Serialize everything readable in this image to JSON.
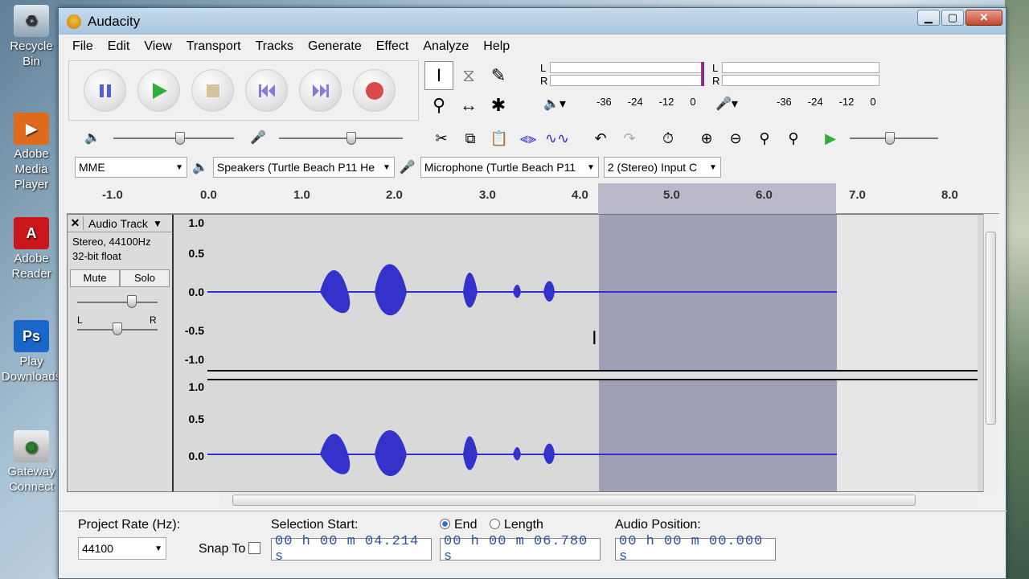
{
  "desktop": {
    "icons": [
      "Recycle Bin",
      "Adobe Media Player",
      "Adobe Reader",
      "Play Downloads",
      "Gateway Connect"
    ]
  },
  "window": {
    "title": "Audacity"
  },
  "menu": [
    "File",
    "Edit",
    "View",
    "Transport",
    "Tracks",
    "Generate",
    "Effect",
    "Analyze",
    "Help"
  ],
  "meters": {
    "playback_scale": [
      "-36",
      "-24",
      "-12",
      "0"
    ],
    "record_scale": [
      "-36",
      "-24",
      "-12",
      "0"
    ],
    "channel_l": "L",
    "channel_r": "R"
  },
  "devices": {
    "host": "MME",
    "output": "Speakers (Turtle Beach P11 He",
    "input": "Microphone (Turtle Beach P11",
    "channels": "2 (Stereo) Input C"
  },
  "ruler": [
    "-1.0",
    "0.0",
    "1.0",
    "2.0",
    "3.0",
    "4.0",
    "5.0",
    "6.0",
    "7.0",
    "8.0"
  ],
  "track": {
    "name": "Audio Track",
    "format": "Stereo, 44100Hz",
    "bit_depth": "32-bit float",
    "mute": "Mute",
    "solo": "Solo",
    "pan_l": "L",
    "pan_r": "R",
    "scale_ch1": [
      "1.0",
      "0.5",
      "0.0",
      "-0.5",
      "-1.0"
    ],
    "scale_ch2": [
      "1.0",
      "0.5",
      "0.0"
    ]
  },
  "selection_bar": {
    "project_rate_label": "Project Rate (Hz):",
    "project_rate": "44100",
    "snap_to": "Snap To",
    "selection_start_label": "Selection Start:",
    "end_label": "End",
    "length_label": "Length",
    "audio_position_label": "Audio Position:",
    "selection_start": "00 h 00 m 04.214 s",
    "end": "00 h 00 m 06.780 s",
    "audio_position": "00 h 00 m 00.000 s"
  },
  "colors": {
    "waveform": "#3333cc",
    "selection": "#9f9fb8",
    "record": "#d94a4a",
    "play": "#2fae3a"
  }
}
